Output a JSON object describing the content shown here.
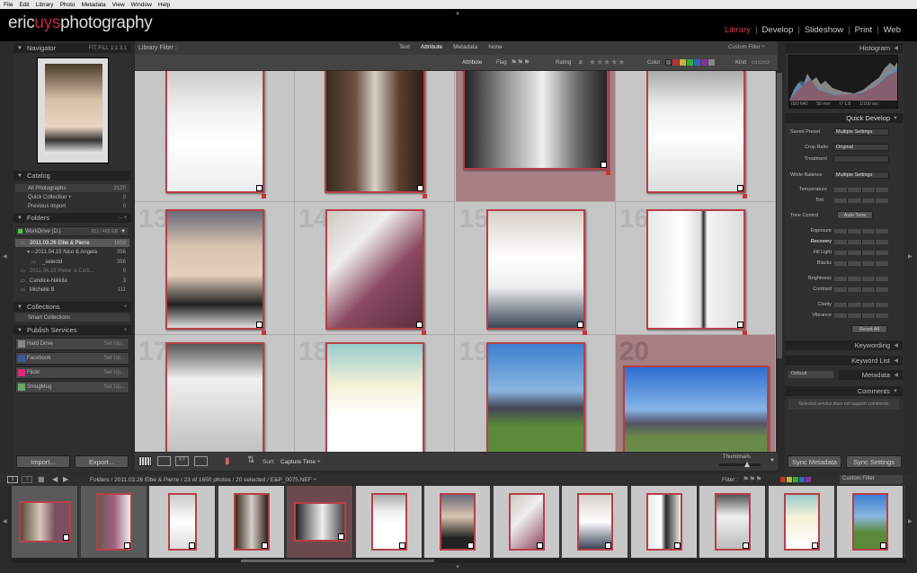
{
  "menu": [
    "File",
    "Edit",
    "Library",
    "Photo",
    "Metadata",
    "View",
    "Window",
    "Help"
  ],
  "identity": {
    "pre": "eric",
    "accent": "uys",
    "post": "photography"
  },
  "modules": [
    "Library",
    "Develop",
    "Slideshow",
    "Print",
    "Web"
  ],
  "navigator": {
    "title": "Navigator",
    "opts": "FIT  FILL  1:1  3:1"
  },
  "catalog": {
    "title": "Catalog",
    "items": [
      {
        "label": "All Photographs",
        "count": "2120"
      },
      {
        "label": "Quick Collection  +",
        "count": "0"
      },
      {
        "label": "Previous Import",
        "count": "0"
      }
    ]
  },
  "folders": {
    "title": "Folders",
    "drive": "WorkDrive (D:)",
    "drive_size": "331 / 465 GB",
    "items": [
      {
        "label": "2011.03.26 Elbe & Pierre",
        "count": "1650"
      },
      {
        "label": "2011.04.15 Nico & Angela",
        "count": "356"
      },
      {
        "label": "_selectd",
        "count": "356"
      },
      {
        "label": "2011.04.23 Pieter & Carli...",
        "count": "0"
      },
      {
        "label": "Candice-Nikkila",
        "count": "3"
      },
      {
        "label": "Michelle B",
        "count": "111"
      }
    ]
  },
  "collections": {
    "title": "Collections",
    "items": [
      "Smart Collections"
    ]
  },
  "publish": {
    "title": "Publish Services",
    "items": [
      {
        "label": "Hard Drive",
        "action": "Set Up..."
      },
      {
        "label": "Facebook",
        "action": "Set Up..."
      },
      {
        "label": "Flickr",
        "action": "Set Up..."
      },
      {
        "label": "SmugMug",
        "action": "Set Up..."
      }
    ]
  },
  "buttons": {
    "import": "Import...",
    "export": "Export...",
    "sync_meta": "Sync Metadata",
    "sync_settings": "Sync Settings"
  },
  "filter": {
    "label": "Library Filter :",
    "tabs": [
      "Text",
      "Attribute",
      "Metadata",
      "None"
    ],
    "custom": "Custom Filter ÷",
    "attribute": "Attribute",
    "flag": "Flag",
    "rating": "Rating",
    "ratingop": "≥",
    "color": "Color",
    "kind": "Kind"
  },
  "grid": {
    "numbers": [
      "",
      "",
      "",
      "",
      "13",
      "14",
      "15",
      "16",
      "17",
      "18",
      "19",
      "20"
    ]
  },
  "toolbar": {
    "sort_label": "Sort:",
    "sort_value": "Capture Time ÷",
    "thumbs": "Thumbnails"
  },
  "histogram": {
    "title": "Histogram",
    "iso": "ISO 640",
    "focal": "56 mm",
    "ap": "f / 1.8",
    "ss": "1/100 sec"
  },
  "quick": {
    "title": "Quick Develop",
    "saved": "Saved Preset",
    "saved_val": "Multiple Settings",
    "crop": "Crop Ratio",
    "crop_val": "Original",
    "treat": "Treatment",
    "wb": "White Balance",
    "wb_val": "Multiple Settings",
    "temp": "Temperature",
    "tint": "Tint",
    "tone": "Tone Control",
    "auto": "Auto Tone",
    "sliders": [
      "Exposure",
      "Recovery",
      "Fill Light",
      "Blacks",
      "Brightness",
      "Contrast",
      "Clarity",
      "Vibrance"
    ],
    "reset": "Reset All"
  },
  "panels": {
    "keywording": "Keywording",
    "kwlist": "Keyword List",
    "metadata": "Metadata",
    "default": "Default",
    "comments": "Comments",
    "comment_msg": "Selected service does not support comments"
  },
  "filmstrip": {
    "path": "Folders / 2011.03.26 Elbe & Pierre / 23 of 1650 photos / 20 selected / E&P_0075.NEF ÷",
    "filter": "Filter :",
    "custom": "Custom Filter"
  },
  "colors": {
    "accent": "#c8253c",
    "label_red": "#b5404a"
  }
}
